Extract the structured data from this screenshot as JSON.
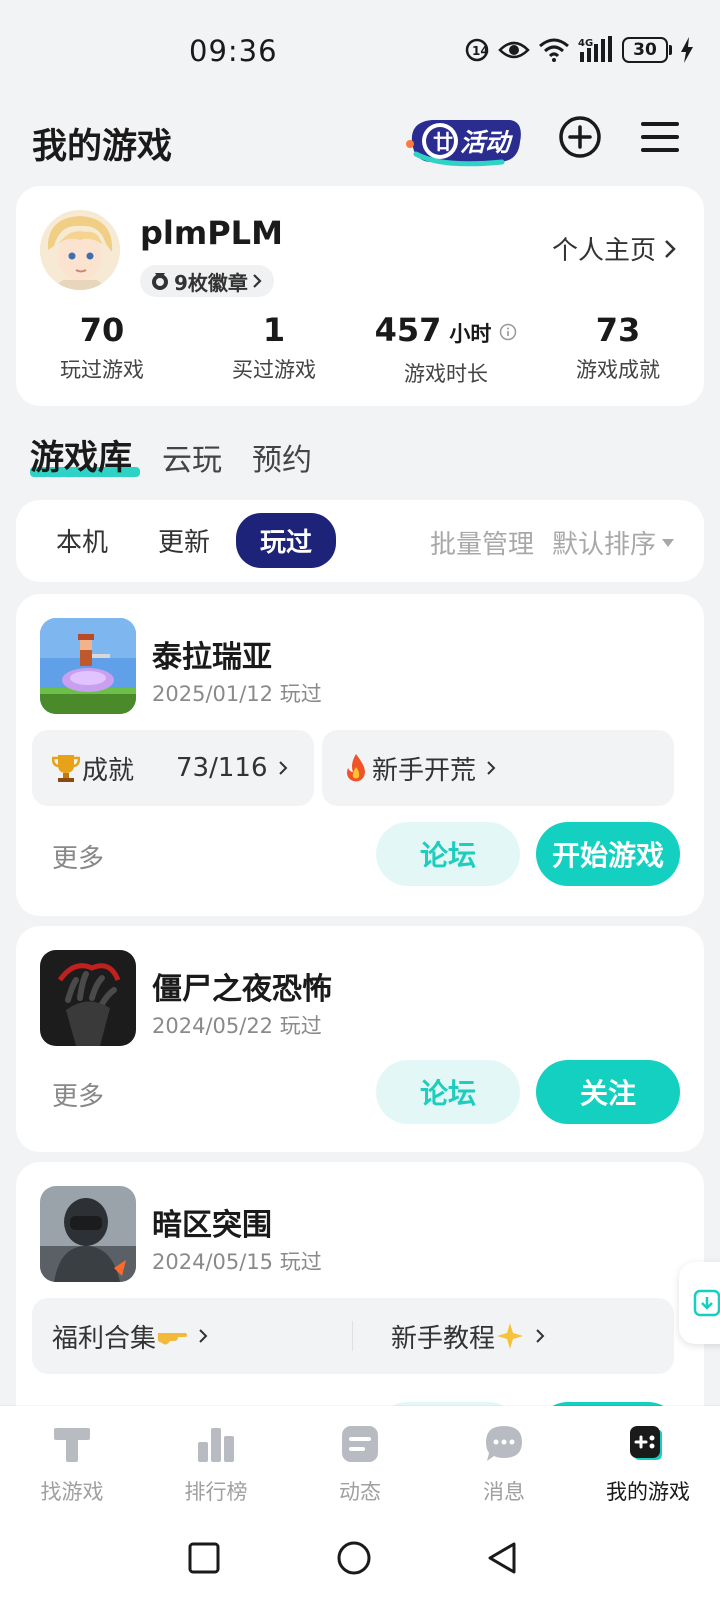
{
  "status_bar": {
    "time": "09:36",
    "network": "4G",
    "battery": "30"
  },
  "header": {
    "title": "我的游戏",
    "activity_label": "活动",
    "add_icon": "plus-circle-icon",
    "menu_icon": "hamburger-menu-icon"
  },
  "profile": {
    "username": "plmPLM",
    "badges": "9枚徽章",
    "homepage": "个人主页",
    "stats": [
      {
        "value": "70",
        "unit": "",
        "label": "玩过游戏"
      },
      {
        "value": "1",
        "unit": "",
        "label": "买过游戏"
      },
      {
        "value": "457",
        "unit": "小时",
        "label": "游戏时长"
      },
      {
        "value": "73",
        "unit": "",
        "label": "游戏成就"
      }
    ]
  },
  "main_tabs": [
    "游戏库",
    "云玩",
    "预约"
  ],
  "filters": {
    "tabs": [
      "本机",
      "更新",
      "玩过"
    ],
    "active": "玩过",
    "batch": "批量管理",
    "sort": "默认排序"
  },
  "games": [
    {
      "name": "泰拉瑞亚",
      "date": "2025/01/12 玩过",
      "achievement_label": "成就",
      "achievement_value": "73/116",
      "tag": "新手开荒",
      "more": "更多",
      "forum": "论坛",
      "primary": "开始游戏"
    },
    {
      "name": "僵尸之夜恐怖",
      "date": "2024/05/22 玩过",
      "more": "更多",
      "forum": "论坛",
      "primary": "关注"
    },
    {
      "name": "暗区突围",
      "date": "2024/05/15 玩过",
      "left_tag": "福利合集",
      "right_tag": "新手教程"
    }
  ],
  "bottom_nav": [
    {
      "label": "找游戏",
      "icon": "find-games-icon"
    },
    {
      "label": "排行榜",
      "icon": "ranking-icon"
    },
    {
      "label": "动态",
      "icon": "feed-icon"
    },
    {
      "label": "消息",
      "icon": "message-icon"
    },
    {
      "label": "我的游戏",
      "icon": "my-games-icon"
    }
  ],
  "colors": {
    "accent": "#14d0c0",
    "active_filter": "#1e237a",
    "background": "#f2f3f5"
  }
}
